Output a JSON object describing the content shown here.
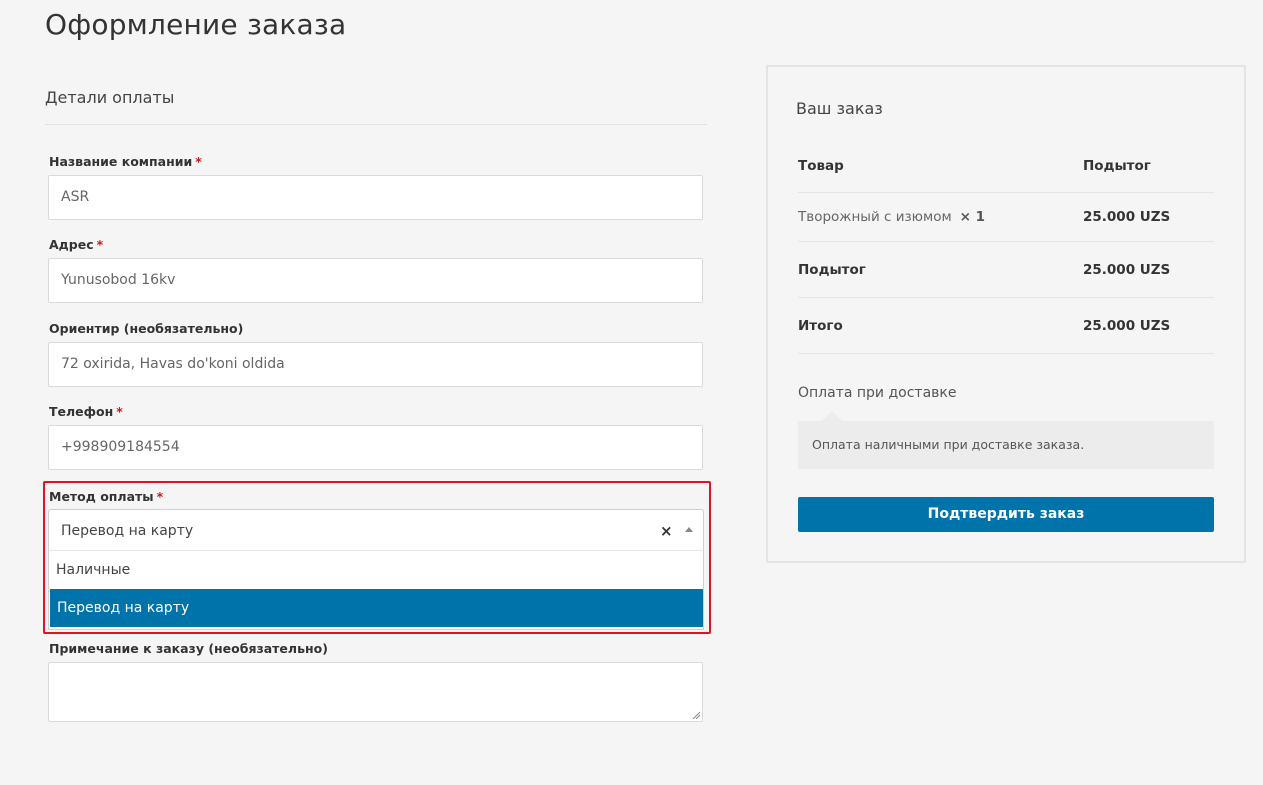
{
  "page": {
    "title": "Оформление заказа"
  },
  "billing": {
    "heading": "Детали оплаты",
    "fields": {
      "company": {
        "label": "Название компании",
        "required": "*",
        "value": "ASR"
      },
      "address": {
        "label": "Адрес",
        "required": "*",
        "value": "Yunusobod 16kv"
      },
      "landmark": {
        "label": "Ориентир (необязательно)",
        "value": "72 oxirida, Havas do'koni oldida"
      },
      "phone": {
        "label": "Телефон",
        "required": "*",
        "value": "+998909184554"
      },
      "payment_method": {
        "label": "Метод оплаты",
        "required": "*",
        "selected": "Перевод на карту",
        "clear_symbol": "×",
        "options": [
          "Наличные",
          "Перевод на карту"
        ]
      },
      "note": {
        "label": "Примечание к заказу (необязательно)",
        "value": ""
      }
    }
  },
  "order": {
    "heading": "Ваш заказ",
    "columns": {
      "product": "Товар",
      "subtotal": "Подытог"
    },
    "items": [
      {
        "name": "Творожный с изюмом",
        "qty": "× 1",
        "total": "25.000 UZS"
      }
    ],
    "subtotal": {
      "label": "Подытог",
      "value": "25.000 UZS"
    },
    "total": {
      "label": "Итого",
      "value": "25.000 UZS"
    },
    "payment": {
      "method_label": "Оплата при доставке",
      "description": "Оплата наличными при доставке заказа."
    },
    "confirm_label": "Подтвердить заказ"
  },
  "colors": {
    "accent": "#0073aa",
    "required": "#cc1818",
    "highlight": "#e0141c"
  }
}
